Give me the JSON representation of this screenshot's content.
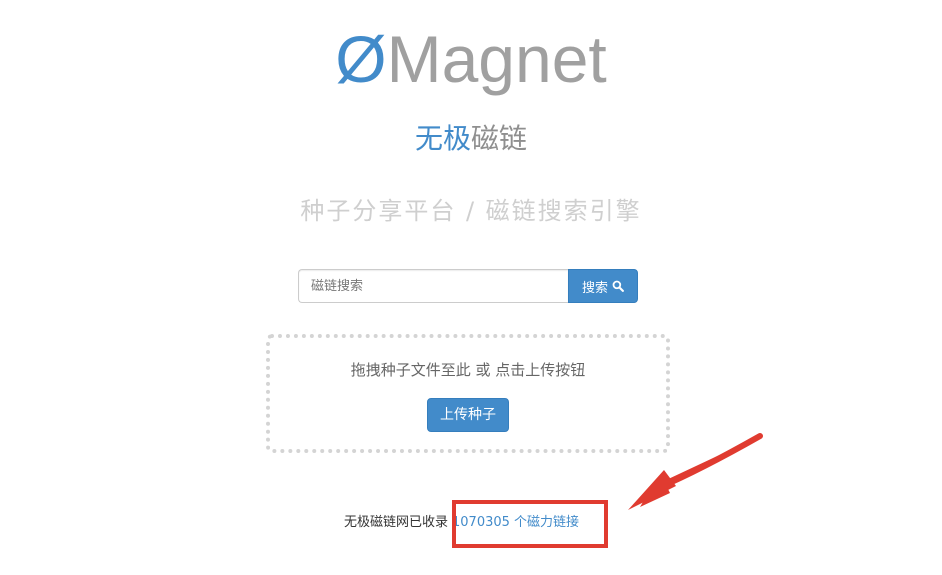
{
  "logo": {
    "slash": "Ø",
    "name": "Magnet"
  },
  "site_name": {
    "part1": "无极",
    "part2": "磁链"
  },
  "tagline": "种子分享平台 / 磁链搜索引擎",
  "search": {
    "placeholder": "磁链搜索",
    "button_label": "搜索",
    "button_icon": "search-icon"
  },
  "dropzone": {
    "hint": "拖拽种子文件至此 或 点击上传按钮",
    "upload_label": "上传种子"
  },
  "stats": {
    "prefix": "无极磁链网已收录",
    "count_link": "1070305 个磁力链接"
  },
  "colors": {
    "primary": "#428bca",
    "annotation_red": "#e03b30",
    "logo_gray": "#a0a0a0"
  }
}
